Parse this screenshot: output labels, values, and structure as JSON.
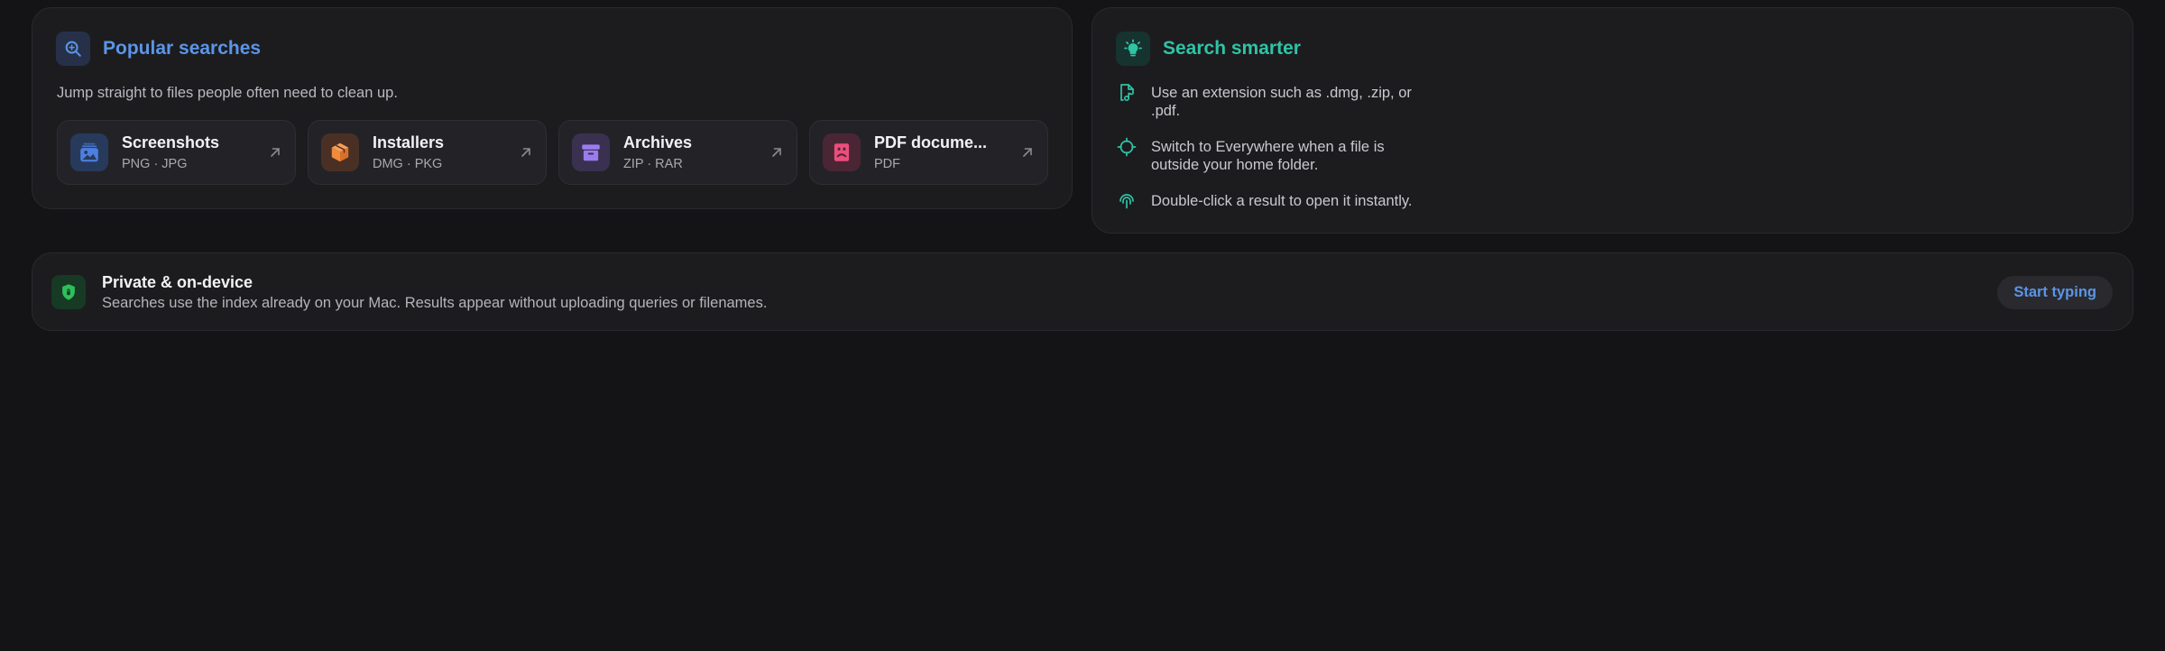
{
  "popular": {
    "title": "Popular searches",
    "subtitle": "Jump straight to files people often need to clean up.",
    "icon": "magnifier-icon",
    "cards": [
      {
        "title": "Screenshots",
        "subtitle": "PNG · JPG",
        "icon": "photo-icon",
        "color": "#4d7fe0",
        "bg": "#283a5c"
      },
      {
        "title": "Installers",
        "subtitle": "DMG · PKG",
        "icon": "package-icon",
        "color": "#f08a3c",
        "bg": "#4a3024"
      },
      {
        "title": "Archives",
        "subtitle": "ZIP · RAR",
        "icon": "archive-box-icon",
        "color": "#9b7cf0",
        "bg": "#3a3150"
      },
      {
        "title": "PDF docume...",
        "subtitle": "PDF",
        "icon": "pdf-document-icon",
        "color": "#ec4d7c",
        "bg": "#4a2634"
      }
    ]
  },
  "tips": {
    "title": "Search smarter",
    "icon": "lightbulb-icon",
    "items": [
      {
        "text": "Use an extension such as .dmg, .zip, or .pdf.",
        "icon": "file-music-icon"
      },
      {
        "text": "Switch to Everywhere when a file is outside your home folder.",
        "icon": "crosshair-icon"
      },
      {
        "text": "Double-click a result to open it instantly.",
        "icon": "fingerprint-tap-icon"
      }
    ]
  },
  "privacy": {
    "title": "Private & on-device",
    "description": "Searches use the index already on your Mac. Results appear without uploading queries or filenames.",
    "button": "Start typing",
    "icon": "shield-icon"
  },
  "colors": {
    "accent_blue": "#5b95e8",
    "accent_teal": "#2fc4a4",
    "accent_green": "#2fbf5a"
  }
}
